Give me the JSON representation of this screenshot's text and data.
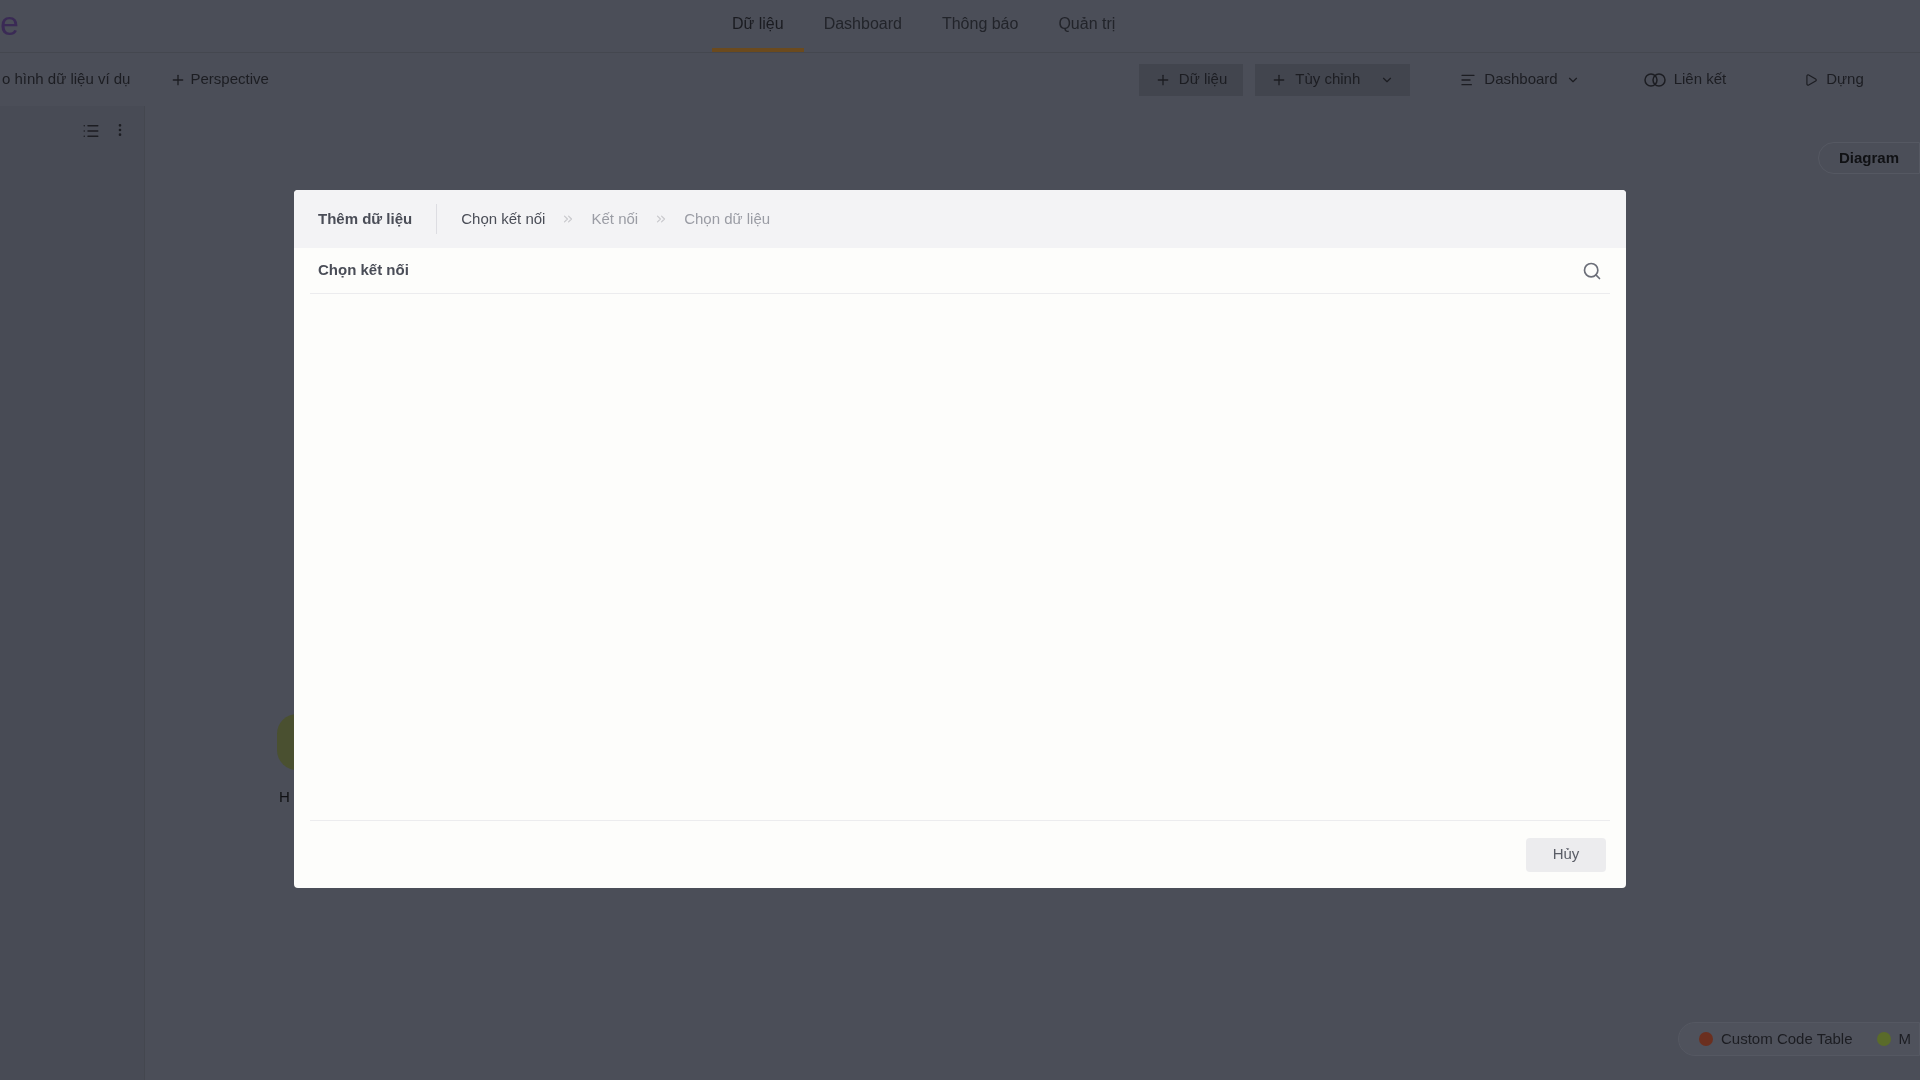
{
  "logo": {
    "text": "e"
  },
  "tabs": [
    {
      "label": "Dữ liệu",
      "selected": true
    },
    {
      "label": "Dashboard",
      "selected": false
    },
    {
      "label": "Thông báo",
      "selected": false
    },
    {
      "label": "Quản trị",
      "selected": false
    }
  ],
  "toolbar": {
    "model_name": "o hình dữ liệu ví dụ",
    "perspective": "Perspective",
    "add_data": "Dữ liệu",
    "customize": "Tùy chỉnh",
    "dashboard": "Dashboard",
    "link": "Liên kết",
    "build": "Dựng"
  },
  "canvas": {
    "diagram_button": "Diagram",
    "node_label": "H",
    "legend": [
      {
        "label": "Custom Code Table",
        "color": "#6b2f1f"
      },
      {
        "label": "M",
        "color": "#5a6b2a"
      }
    ]
  },
  "dialog": {
    "title": "Thêm dữ liệu",
    "steps": [
      {
        "label": "Chọn kết nối",
        "selected": true
      },
      {
        "label": "Kết nối",
        "selected": false
      },
      {
        "label": "Chọn dữ liệu",
        "selected": false
      }
    ],
    "search_label": "Chọn kết nối",
    "cancel": "Hủy"
  }
}
